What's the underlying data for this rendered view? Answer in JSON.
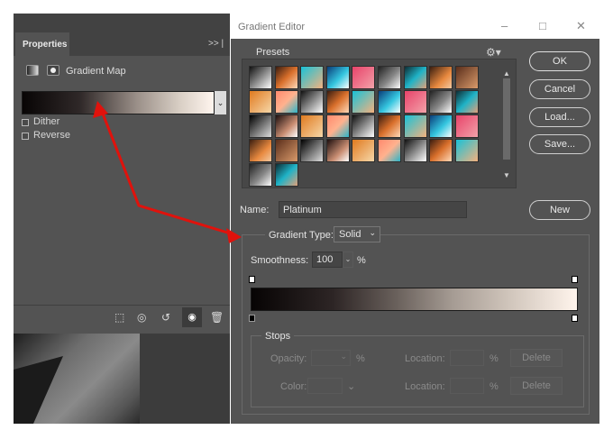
{
  "properties_panel": {
    "tab_label": "Properties",
    "menu_glyph": ">>  |",
    "adjustment_name": "Gradient Map",
    "dither_label": "Dither",
    "reverse_label": "Reverse",
    "dither_checked": false,
    "reverse_checked": false
  },
  "gradient_editor": {
    "title": "Gradient Editor",
    "window_controls": [
      "–",
      "□",
      "✕"
    ],
    "presets_label": "Presets",
    "buttons": {
      "ok": "OK",
      "cancel": "Cancel",
      "load": "Load...",
      "save": "Save...",
      "new": "New"
    },
    "name_label": "Name:",
    "name_value": "Platinum",
    "gradient_type_label": "Gradient Type:",
    "gradient_type_value": "Solid",
    "smoothness_label": "Smoothness:",
    "smoothness_value": "100",
    "smoothness_unit": "%",
    "stops": {
      "group_label": "Stops",
      "opacity_label": "Opacity:",
      "color_label": "Color:",
      "location_label": "Location:",
      "percent": "%",
      "delete_label": "Delete"
    }
  },
  "colors": {
    "panel_bg": "#535353",
    "annotation_arrow": "#e0120c"
  }
}
